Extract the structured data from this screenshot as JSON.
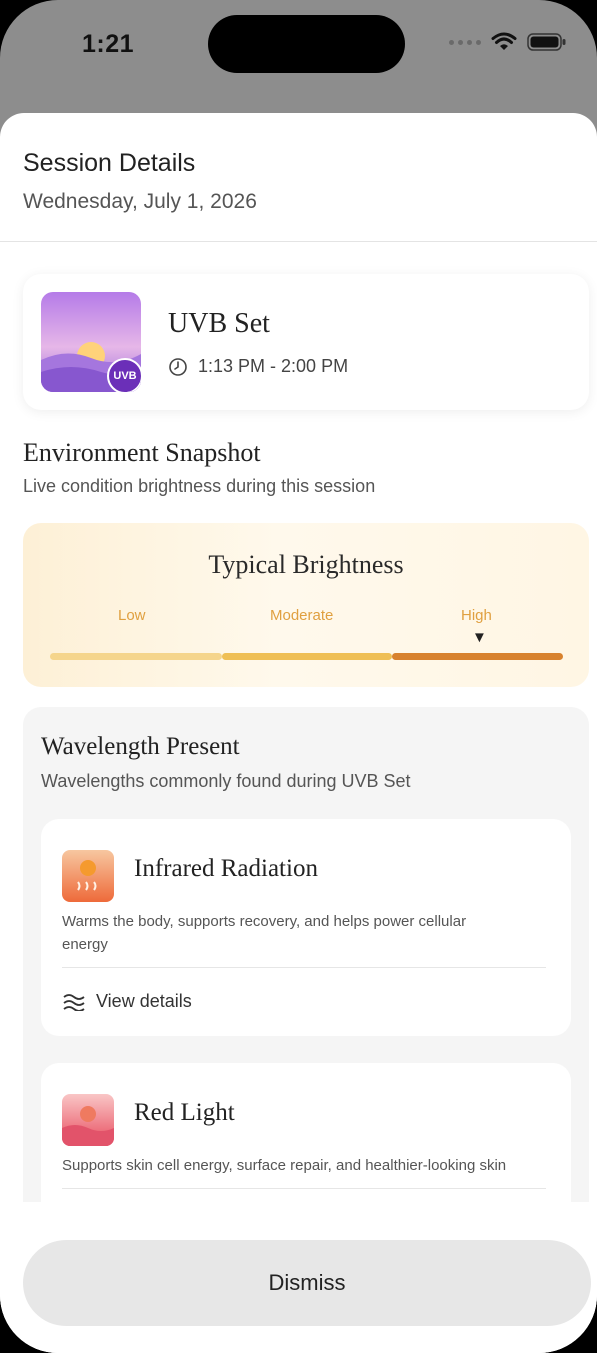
{
  "status_bar": {
    "time": "1:21"
  },
  "header": {
    "title": "Session Details",
    "date": "Wednesday, July 1, 2026"
  },
  "session": {
    "name": "UVB Set",
    "badge": "UVB",
    "time_range": "1:13 PM - 2:00 PM"
  },
  "environment": {
    "title": "Environment Snapshot",
    "subtitle": "Live condition brightness during this session",
    "brightness_title": "Typical Brightness",
    "levels": [
      "Low",
      "Moderate",
      "High"
    ],
    "selected_level": "High"
  },
  "wavelengths": {
    "title": "Wavelength Present",
    "subtitle": "Wavelengths commonly found during UVB Set",
    "items": [
      {
        "name": "Infrared Radiation",
        "description": "Warms the body, supports recovery, and helps power cellular energy",
        "action": "View details"
      },
      {
        "name": "Red Light",
        "description": "Supports skin cell energy, surface repair, and healthier-looking skin"
      }
    ]
  },
  "footer": {
    "dismiss_label": "Dismiss"
  },
  "colors": {
    "accent_purple": "#6b2fb8",
    "brightness_low": "#f5d58c",
    "brightness_moderate": "#efbf55",
    "brightness_high": "#d8822e"
  }
}
